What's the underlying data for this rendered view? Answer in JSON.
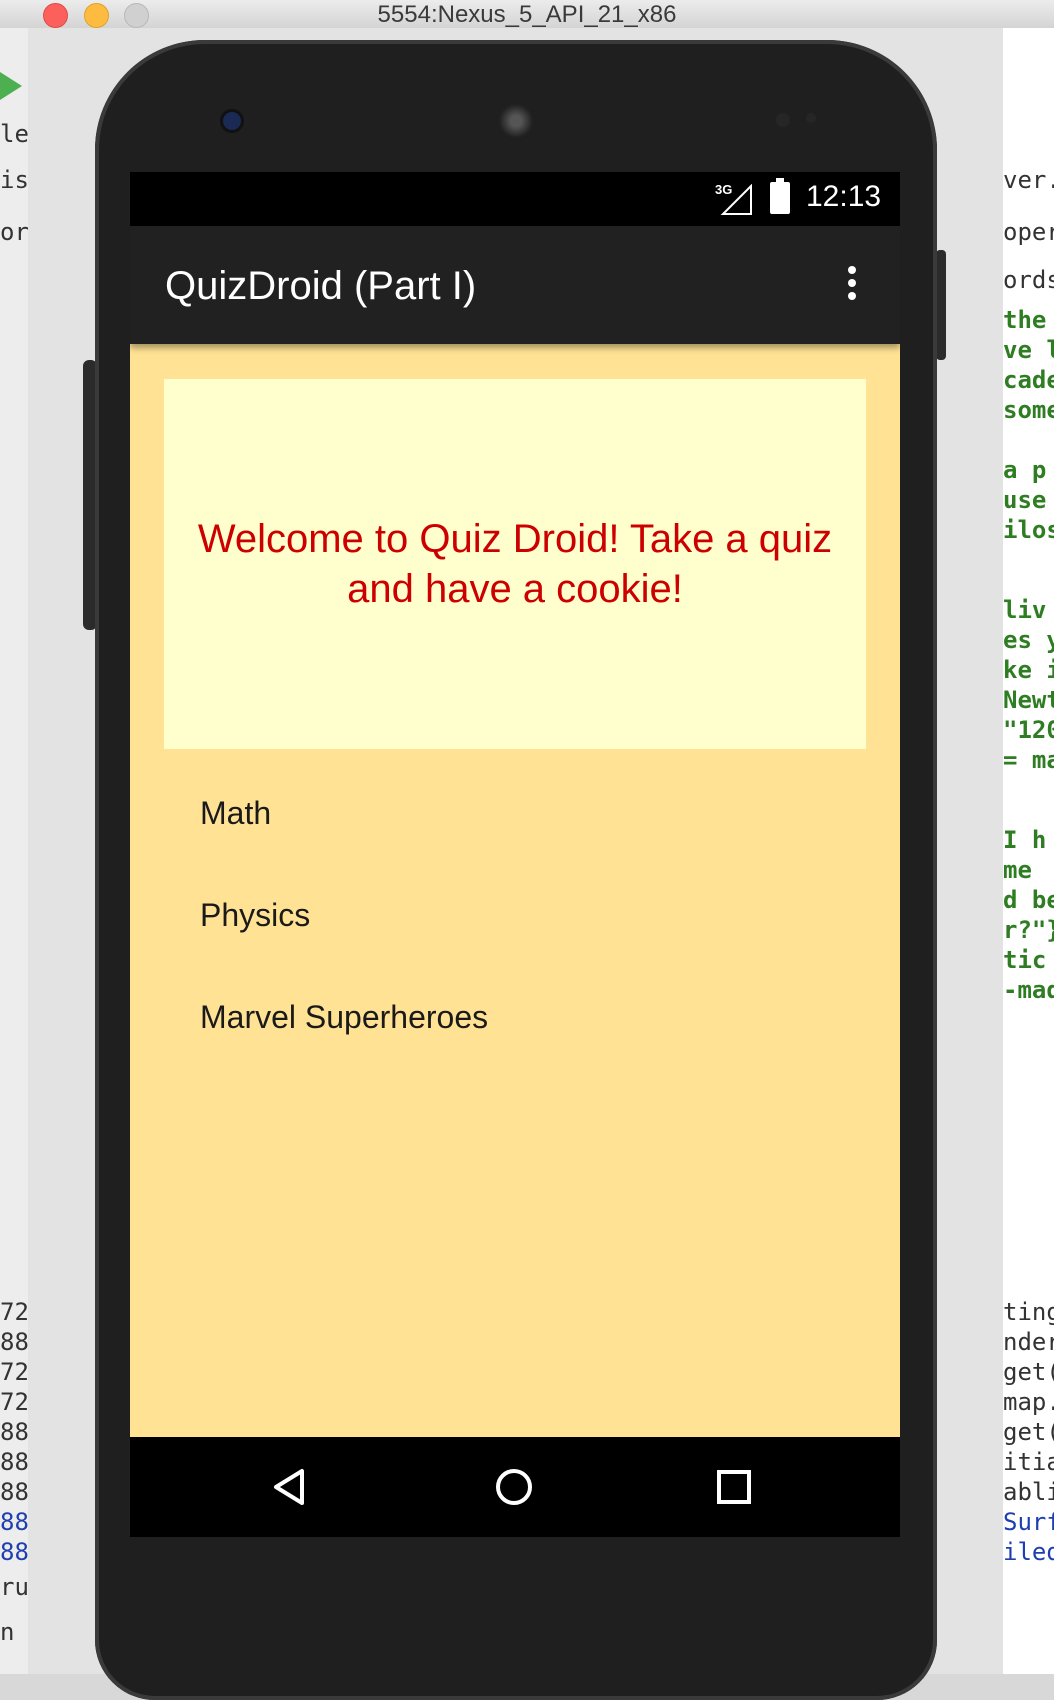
{
  "window": {
    "title": "5554:Nexus_5_API_21_x86"
  },
  "ide_left_lines": [
    {
      "text": "lek",
      "cls": ""
    },
    {
      "text": "ist",
      "cls": ""
    },
    {
      "text": "orc",
      "cls": ""
    },
    {
      "text": "72",
      "cls": ""
    },
    {
      "text": "88",
      "cls": ""
    },
    {
      "text": "72",
      "cls": ""
    },
    {
      "text": "72",
      "cls": ""
    },
    {
      "text": "88",
      "cls": ""
    },
    {
      "text": "88",
      "cls": ""
    },
    {
      "text": "88",
      "cls": ""
    },
    {
      "text": "88",
      "cls": "blue"
    },
    {
      "text": "88",
      "cls": "blue"
    },
    {
      "text": "ru",
      "cls": ""
    },
    {
      "text": "n",
      "cls": ""
    }
  ],
  "ide_right_lines": [
    {
      "text": "ver.xr",
      "cls": "plain"
    },
    {
      "text": "operl",
      "cls": "plain"
    },
    {
      "text": "ords",
      "cls": "plain"
    },
    {
      "text": " the",
      "cls": ""
    },
    {
      "text": "ve l",
      "cls": ""
    },
    {
      "text": "cade",
      "cls": ""
    },
    {
      "text": "some",
      "cls": ""
    },
    {
      "text": " a p",
      "cls": ""
    },
    {
      "text": " use",
      "cls": ""
    },
    {
      "text": "ilos",
      "cls": ""
    },
    {
      "text": " liv",
      "cls": ""
    },
    {
      "text": "es y",
      "cls": ""
    },
    {
      "text": "ke i",
      "cls": ""
    },
    {
      "text": "Newt",
      "cls": ""
    },
    {
      "text": "\"120",
      "cls": ""
    },
    {
      "text": "= ma",
      "cls": ""
    },
    {
      "text": " I h",
      "cls": ""
    },
    {
      "text": " me ",
      "cls": ""
    },
    {
      "text": "d be",
      "cls": ""
    },
    {
      "text": "r?\"}",
      "cls": ""
    },
    {
      "text": "tic ",
      "cls": ""
    },
    {
      "text": "-mad",
      "cls": ""
    },
    {
      "text": "ting",
      "cls": "plain"
    },
    {
      "text": "nder",
      "cls": "plain"
    },
    {
      "text": "get(",
      "cls": "plain"
    },
    {
      "text": "map.",
      "cls": "plain"
    },
    {
      "text": "get(",
      "cls": "plain"
    },
    {
      "text": "itia",
      "cls": "plain"
    },
    {
      "text": "abli",
      "cls": "plain"
    },
    {
      "text": "Surf",
      "cls": "blue"
    },
    {
      "text": "iled",
      "cls": "blue"
    }
  ],
  "status": {
    "network": "3G",
    "time": "12:13"
  },
  "app": {
    "title": "QuizDroid (Part I)",
    "welcome": "Welcome to Quiz Droid! Take a quiz and have a cookie!",
    "topics": [
      "Math",
      "Physics",
      "Marvel Superheroes"
    ]
  },
  "colors": {
    "screen_bg": "#ffe294",
    "welcome_bg": "#ffffcd",
    "welcome_text": "#cc0000",
    "actionbar": "#212121"
  }
}
